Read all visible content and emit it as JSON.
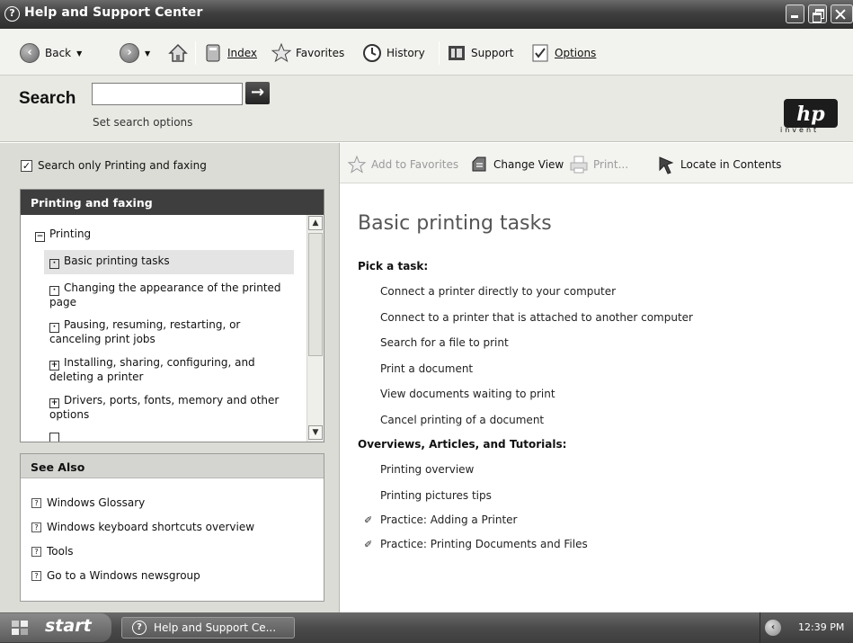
{
  "window": {
    "title": "Help and Support Center"
  },
  "nav": {
    "back": "Back",
    "index": "Index",
    "favorites": "Favorites",
    "history": "History",
    "support": "Support",
    "options": "Options"
  },
  "search": {
    "label": "Search",
    "value": "",
    "set_options": "Set search options"
  },
  "branding": {
    "logo": "hp",
    "tagline": "invent"
  },
  "left": {
    "scope_checkbox_label": "Search only Printing and faxing",
    "scope_checked": true,
    "topic_header": "Printing and faxing",
    "tree": [
      {
        "label": "Printing",
        "expander": "−"
      },
      {
        "label": "Basic printing tasks",
        "expander": "·",
        "selected": true
      },
      {
        "label": "Changing the appearance of the printed page",
        "expander": "·"
      },
      {
        "label": "Pausing, resuming, restarting, or canceling print jobs",
        "expander": "·"
      },
      {
        "label": "Installing, sharing, configuring, and deleting a printer",
        "expander": "+"
      },
      {
        "label": "Drivers, ports, fonts, memory and other options",
        "expander": "+"
      }
    ],
    "see_also_header": "See Also",
    "see_also": [
      "Windows Glossary",
      "Windows keyboard shortcuts overview",
      "Tools",
      "Go to a Windows newsgroup"
    ]
  },
  "content_toolbar": {
    "add_to_favorites": "Add to Favorites",
    "change_view": "Change View",
    "print": "Print...",
    "locate_in_contents": "Locate in Contents"
  },
  "content": {
    "title": "Basic printing tasks",
    "pick_task_heading": "Pick a task:",
    "tasks": [
      "Connect a printer directly to your computer",
      "Connect to a printer that is attached to another computer",
      "Search for a file to print",
      "Print a document",
      "View documents waiting to print",
      "Cancel printing of a document"
    ],
    "overviews_heading": "Overviews, Articles, and Tutorials:",
    "overviews": [
      "Printing overview",
      "Printing pictures tips"
    ],
    "practices": [
      "Practice: Adding a Printer",
      "Practice: Printing Documents and Files"
    ]
  },
  "taskbar": {
    "start": "start",
    "task_item": "Help and Support Ce...",
    "clock": "12:39 PM"
  }
}
